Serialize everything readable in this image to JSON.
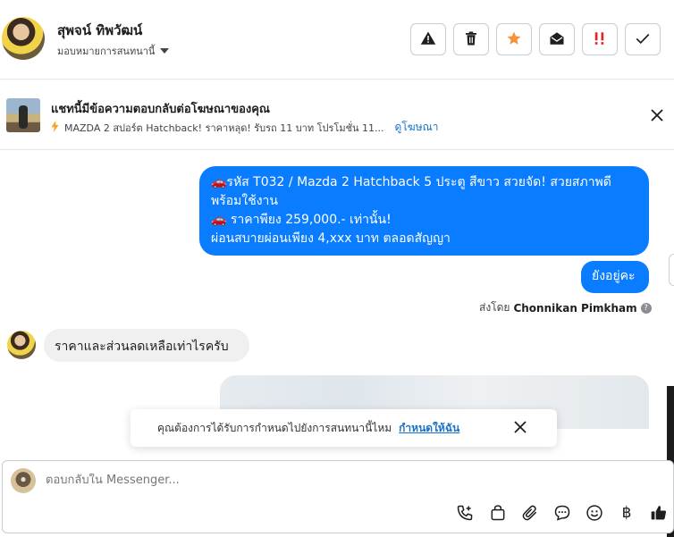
{
  "header": {
    "contact_name": "สุพจน์ ทิพวัฒน์",
    "assign_label": "มอบหมายการสนทนานี้"
  },
  "ad_banner": {
    "title": "แชทนี้มีข้อความตอบกลับต่อโฆษณาของคุณ",
    "ad_text": "MAZDA 2 สปอร์ต Hatchback! ราคาหลุด! รับรถ 11 บาท โปรโมชั่น 11...",
    "link_label": "ดูโฆษณา"
  },
  "messages": {
    "outgoing_1_lines": [
      "🚗รหัส T032 /  Mazda 2 Hatchback 5 ประตู สีขาว สวยจัด! สวยสภาพดี",
      "พร้อมใช้งาน",
      "🚗 ราคาพียง 259,000.- เท่านั้น!",
      "ผ่อนสบายผ่อนเพียง 4,xxx บาท ตลอดสัญญา"
    ],
    "outgoing_2": "ยังอยู่คะ",
    "sent_by_prefix": "ส่งโดย",
    "sent_by_name": "Chonnikan Pimkham",
    "incoming_1": "ราคาและส่วนลดเหลือเท่าไรครับ"
  },
  "toast": {
    "text": "คุณต้องการได้รับการกำหนดไปยังการสนทนานี้ไหม",
    "link_label": "กำหนดให้ฉัน"
  },
  "composer": {
    "placeholder": "ตอบกลับใน Messenger..."
  },
  "colors": {
    "outgoing_bubble": "#0a7cff",
    "incoming_bubble": "#f0f0f0",
    "star": "#f7923a",
    "important": "#e0242b",
    "link": "#1a73c9"
  },
  "icons": {
    "actions": [
      "warning-icon",
      "trash-icon",
      "star-icon",
      "mail-open-icon",
      "important-icon",
      "check-icon"
    ],
    "composer_tools": [
      "phone-plus-icon",
      "bag-icon",
      "paperclip-icon",
      "chat-bubble-icon",
      "smiley-icon",
      "baht-icon",
      "thumbs-up-icon"
    ]
  }
}
